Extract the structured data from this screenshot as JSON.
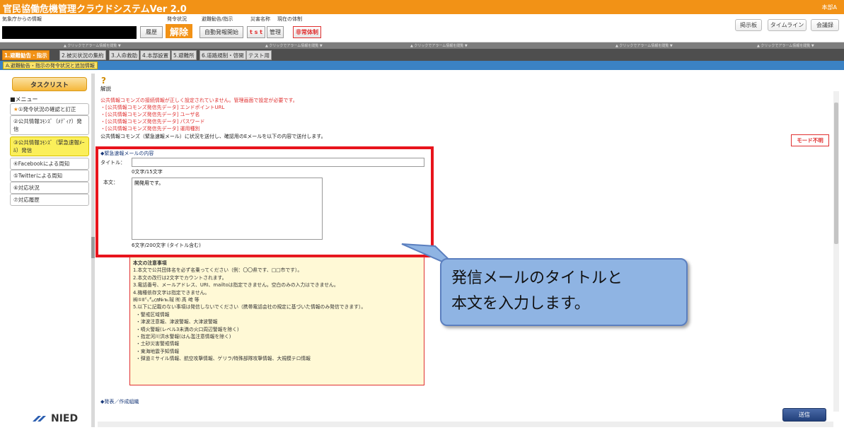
{
  "app": {
    "title": "官民協働危機管理クラウドシステムVer 2.0",
    "user": "本部A"
  },
  "header": {
    "agency_label": "気象庁からの情報",
    "status_label": "発令状況",
    "evac_label": "避難勧告/指示",
    "disaster_label": "災害名称",
    "system_label": "現在の体制",
    "history_btn": "履歴",
    "status_value": "解除",
    "auto_issue_btn": "自動発報開始",
    "disaster_name": "t s t",
    "manage_btn": "管理",
    "system_value": "非常体制",
    "board_btn": "掲示板",
    "timeline_btn": "タイムライン",
    "meeting_btn": "会議録"
  },
  "alarm_strip": [
    "▲ クリックでアラーム情報を閲覧 ▼",
    "▲ クリックでアラーム情報を閲覧 ▼",
    "▲ クリックでアラーム情報を閲覧 ▼",
    "▲ クリックでアラーム情報を閲覧 ▼",
    "▲ クリックでアラーム情報を閲覧 ▼"
  ],
  "tabs": [
    "1.避難勧告・指示",
    "2.被災状況の集約",
    "3.人命救助",
    "4.本部設置",
    "5.避難所",
    "6.道路規制・啓開",
    "テスト用"
  ],
  "subtab": "A.避難勧告・指示の発令状況と追加情報",
  "sidebar": {
    "tasklist": "タスクリスト",
    "menu_label": "■メニュー",
    "items": [
      "①発令状況の確認と訂正",
      "②公共情報ｺﾓﾝｽﾞ（ﾒﾃﾞｨｱ）発信",
      "③公共情報ｺﾓﾝｽﾞ（緊急速報ﾒｰﾙ）発信",
      "④Facebookによる周知",
      "⑤Twitterによる周知",
      "⑥対応状況",
      "⑦対応履歴"
    ],
    "logo": "NIED"
  },
  "main": {
    "help_label": "解説",
    "warnings": [
      "公共情報コモンズの接続情報が正しく設定されていません。管理画面で設定が必要です。",
      "・[公共情報コモンズ発信先データ] エンドポイントURL",
      "・[公共情報コモンズ発信先データ] ユーザ名",
      "・[公共情報コモンズ発信先データ] パスワード",
      "・[公共情報コモンズ発信先データ] 運用種別"
    ],
    "note_line": "公共情報コモンズ（緊急速報メール）に状況を送付し、確認用のEメールを以下の内容で送付します。",
    "mode_btn": "モード不明",
    "section_title": "◆緊急速報メールの内容",
    "title_label": "タイトル：",
    "title_value": "",
    "title_count": "0文字/15文字",
    "body_label": "本文：",
    "body_value": "開発用です。",
    "body_count": "6文字/200文字 (タイトル含む)",
    "notes": {
      "heading": "本文の注意事項",
      "lines": [
        "1.本文で公共団体名を必ず名乗ってください（例：〇〇県です、□□市です）。",
        "2.本文の改行は2文字でカウントされます。",
        "3.電話番号、メールアドレス、URI、mailtoは指定できません。空白のみの入力はできません。",
        "4.機種依存文字は指定できません。",
        "㈱①Ⅱ㍉㌔㎝№℡㍻ ㈲ 髙 﨑 等",
        "5.以下に記載のない事項は発信しないでください（携帯電話会社の規定に基づいた情報のみ発信できます）。",
        "・警戒区域情報",
        "・津波注意報、津波警報、大津波警報",
        "・噴火警報(レベル3未満の火口周辺警報を除く)",
        "・指定河川洪水警報(はん濫注意情報を除く)",
        "・土砂災害警戒情報",
        "・東海地震予知情報",
        "・弾道ミサイル情報、航空攻撃情報、ゲリラ/特殊部隊攻撃情報、大規模テロ情報"
      ]
    },
    "bottom_section": "◆発表／作成組織",
    "send_btn": "送信"
  },
  "callout": {
    "line1": "発信メールのタイトルと",
    "line2": "本文を入力します。"
  },
  "colors": {
    "accent": "#f29216",
    "highlight": "#e8141c",
    "callout": "#8fb4e3",
    "tabbar": "#3b82c4"
  }
}
